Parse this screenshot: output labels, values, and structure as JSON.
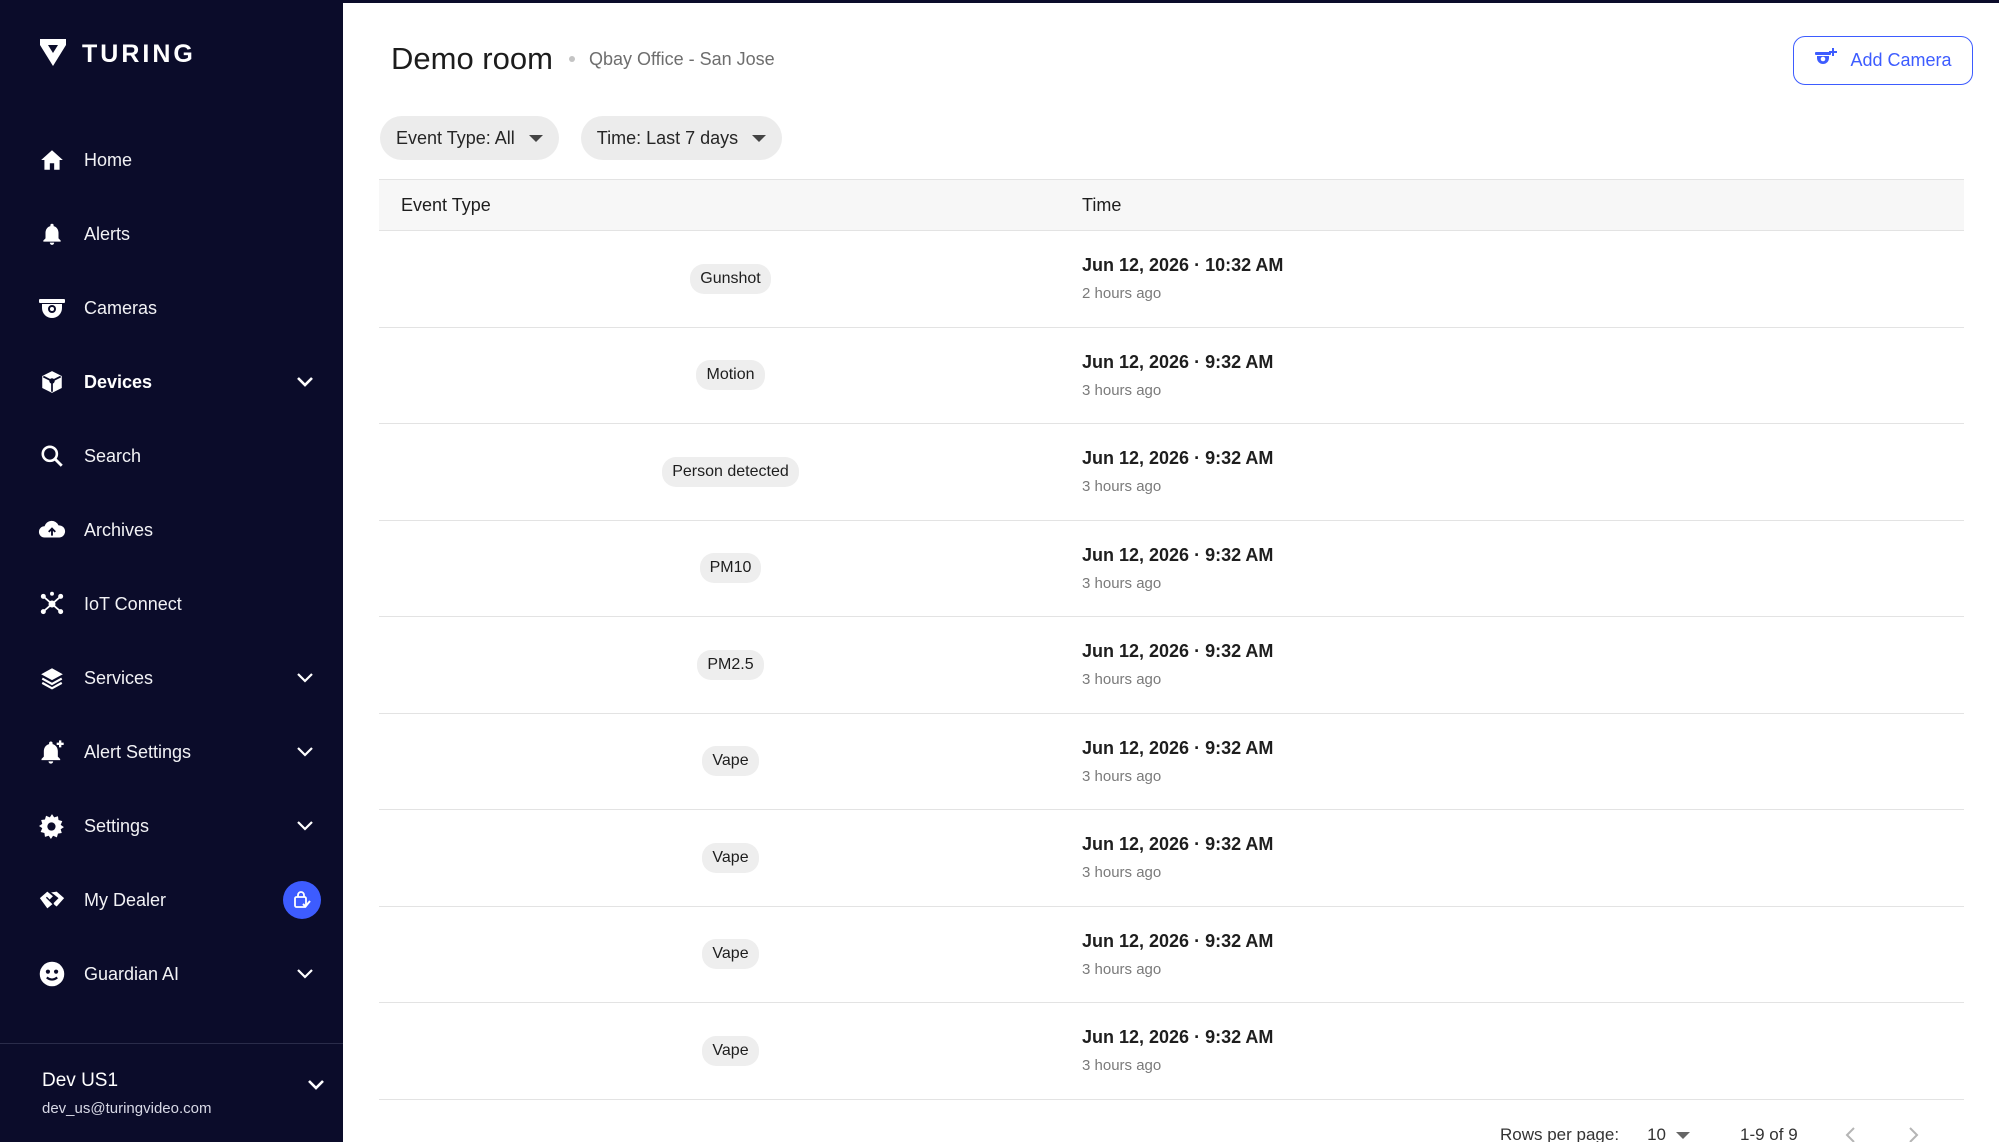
{
  "brand": {
    "name": "TURING"
  },
  "sidebar": {
    "items": [
      {
        "label": "Home",
        "icon": "home-icon",
        "expandable": false
      },
      {
        "label": "Alerts",
        "icon": "bell-icon",
        "expandable": false
      },
      {
        "label": "Cameras",
        "icon": "camera-icon",
        "expandable": false
      },
      {
        "label": "Devices",
        "icon": "box-icon",
        "expandable": true,
        "active": true
      },
      {
        "label": "Search",
        "icon": "search-icon",
        "expandable": false
      },
      {
        "label": "Archives",
        "icon": "cloud-upload-icon",
        "expandable": false
      },
      {
        "label": "IoT Connect",
        "icon": "network-icon",
        "expandable": false
      },
      {
        "label": "Services",
        "icon": "layers-icon",
        "expandable": true
      },
      {
        "label": "Alert Settings",
        "icon": "bell-plus-icon",
        "expandable": true
      },
      {
        "label": "Settings",
        "icon": "gear-icon",
        "expandable": true
      },
      {
        "label": "My Dealer",
        "icon": "handshake-icon",
        "expandable": false,
        "badge_icon": "dealer-badge-icon"
      },
      {
        "label": "Guardian AI",
        "icon": "robot-face-icon",
        "expandable": true
      }
    ],
    "footer": {
      "org": "Dev US1",
      "email": "dev_us@turingvideo.com"
    }
  },
  "header": {
    "title": "Demo room",
    "subtitle": "Qbay Office - San Jose",
    "add_camera_label": "Add Camera"
  },
  "filters": {
    "event_type": "Event Type: All",
    "time": "Time: Last 7 days"
  },
  "table": {
    "columns": [
      "Event Type",
      "Time"
    ],
    "rows": [
      {
        "event": "Gunshot",
        "time": "Jun 12, 2026 · 10:32 AM",
        "relative": "2 hours ago"
      },
      {
        "event": "Motion",
        "time": "Jun 12, 2026 · 9:32 AM",
        "relative": "3 hours ago"
      },
      {
        "event": "Person detected",
        "time": "Jun 12, 2026 · 9:32 AM",
        "relative": "3 hours ago"
      },
      {
        "event": "PM10",
        "time": "Jun 12, 2026 · 9:32 AM",
        "relative": "3 hours ago"
      },
      {
        "event": "PM2.5",
        "time": "Jun 12, 2026 · 9:32 AM",
        "relative": "3 hours ago"
      },
      {
        "event": "Vape",
        "time": "Jun 12, 2026 · 9:32 AM",
        "relative": "3 hours ago"
      },
      {
        "event": "Vape",
        "time": "Jun 12, 2026 · 9:32 AM",
        "relative": "3 hours ago"
      },
      {
        "event": "Vape",
        "time": "Jun 12, 2026 · 9:32 AM",
        "relative": "3 hours ago"
      },
      {
        "event": "Vape",
        "time": "Jun 12, 2026 · 9:32 AM",
        "relative": "3 hours ago"
      }
    ]
  },
  "pagination": {
    "rows_per_page_label": "Rows per page:",
    "rows_per_page": "10",
    "range": "1-9 of 9"
  },
  "colors": {
    "sidebar_bg": "#0b0c2a",
    "accent": "#3d5cff",
    "badge_bg": "#eeeeee"
  }
}
